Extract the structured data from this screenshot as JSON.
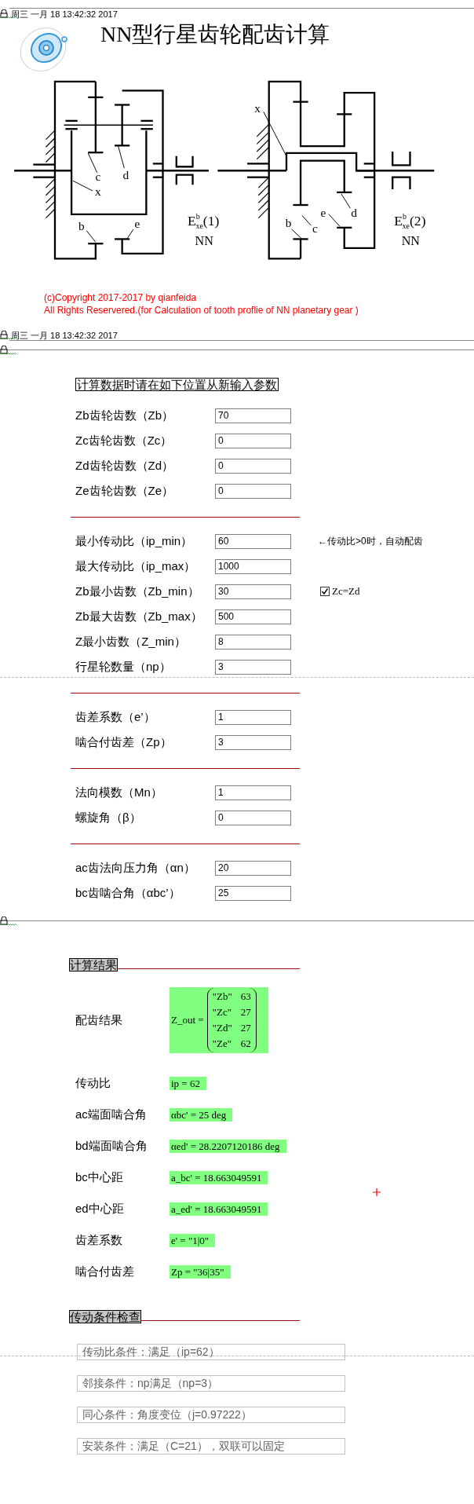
{
  "header": {
    "timestamp": "周三 一月 18 13:42:32 2017"
  },
  "title": "NN型行星齿轮配齿计算",
  "diagrams": [
    {
      "labels": [
        "c",
        "d",
        "x",
        "b",
        "e"
      ],
      "symbol": "E",
      "superscript": "b",
      "subscript": "xe",
      "number": "(1)",
      "type": "NN"
    },
    {
      "labels": [
        "x",
        "d",
        "e",
        "c",
        "b"
      ],
      "symbol": "E",
      "superscript": "b",
      "subscript": "xe",
      "number": "(2)",
      "type": "NN"
    }
  ],
  "copyright": [
    "(c)Copyright 2017-2017 by qianfeida",
    "All Rights Reservered.(for Calculation of tooth proflie of NN planetary gear )"
  ],
  "region_timestamp": "周三 一月 18 13:42:32 2017",
  "input_heading": "计算数据时请在如下位置从新输入参数",
  "input_groups": [
    {
      "rows": [
        {
          "label": "Zb齿轮齿数（Zb）",
          "value": "70"
        },
        {
          "label": "Zc齿轮齿数（Zc）",
          "value": "0"
        },
        {
          "label": "Zd齿轮齿数（Zd）",
          "value": "0"
        },
        {
          "label": "Ze齿轮齿数（Ze）",
          "value": "0"
        }
      ]
    },
    {
      "rows": [
        {
          "label": "最小传动比（ip_min）",
          "value": "60",
          "note": "←传动比>0时，自动配齿"
        },
        {
          "label": "最大传动比（ip_max）",
          "value": "1000"
        },
        {
          "label": "Zb最小齿数（Zb_min）",
          "value": "30",
          "checkbox": {
            "label": "Zc=Zd",
            "checked": true
          }
        },
        {
          "label": "Zb最大齿数（Zb_max）",
          "value": "500"
        },
        {
          "label": "Z最小齿数（Z_min）",
          "value": "8"
        },
        {
          "label": "行星轮数量（np）",
          "value": "3"
        }
      ]
    },
    {
      "rows": [
        {
          "label": "齿差系数（e’）",
          "value": "1"
        },
        {
          "label": "啮合付齿差（Zp）",
          "value": "3"
        }
      ]
    },
    {
      "rows": [
        {
          "label": "法向模数（Mn）",
          "value": "1"
        },
        {
          "label": "螺旋角（β）",
          "value": "0"
        }
      ]
    },
    {
      "rows": [
        {
          "label": "ac齿法向压力角（αn）",
          "value": "20"
        },
        {
          "label": "bc齿啮合角（αbc’）",
          "value": "25"
        }
      ]
    }
  ],
  "results_heading": "计算结果",
  "matrix": {
    "label": "配齿结果",
    "name": "Z_out =",
    "rows": [
      [
        "\"Zb\"",
        "63"
      ],
      [
        "\"Zc\"",
        "27"
      ],
      [
        "\"Zd\"",
        "27"
      ],
      [
        "\"Ze\"",
        "62"
      ]
    ]
  },
  "results": [
    {
      "label": "传动比",
      "value": "ip = 62"
    },
    {
      "label": "ac端面啮合角",
      "value": "αbc' = 25 deg"
    },
    {
      "label": "bd端面啮合角",
      "value": "αed' = 28.2207120186 deg"
    },
    {
      "label": "bc中心距",
      "value": "a_bc' = 18.663049591"
    },
    {
      "label": "ed中心距",
      "value": "a_ed' = 18.663049591"
    },
    {
      "label": "齿差系数",
      "value": "e' = \"1|0\""
    },
    {
      "label": "啮合付齿差",
      "value": "Zp = \"36|35\""
    }
  ],
  "checks_heading": "传动条件检查",
  "checks": [
    "传动比条件：满足（ip=62）",
    "邻接条件：np满足（np=3）",
    "同心条件：角度变位（j=0.97222）",
    "安装条件：满足（C=21），双联可以固定"
  ]
}
